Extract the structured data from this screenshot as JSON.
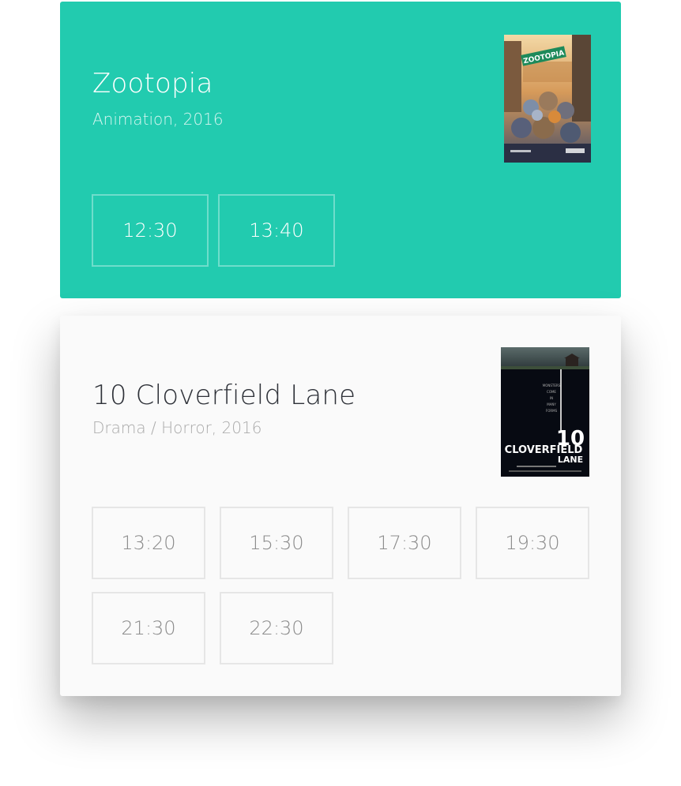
{
  "movies": [
    {
      "title": "Zootopia",
      "meta": "Animation, 2016",
      "poster_icon": "zootopia-poster",
      "accent": "#22cbaf",
      "showtimes": [
        "12:30",
        "13:40"
      ]
    },
    {
      "title": "10 Cloverfield Lane",
      "meta": "Drama / Horror, 2016",
      "poster_icon": "cloverfield-poster",
      "accent": "#fafafa",
      "showtimes": [
        "13:20",
        "15:30",
        "17:30",
        "19:30",
        "21:30",
        "22:30"
      ]
    }
  ]
}
